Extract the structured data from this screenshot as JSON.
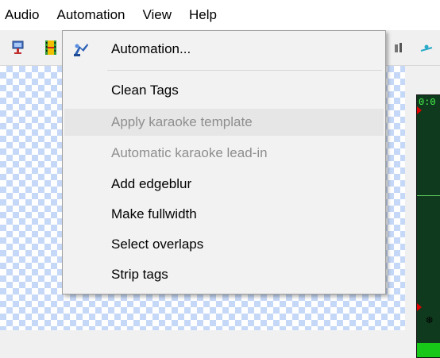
{
  "menubar": {
    "items": [
      "Audio",
      "Automation",
      "View",
      "Help"
    ]
  },
  "automation_menu": {
    "items": [
      {
        "label": "Automation...",
        "enabled": true,
        "icon": "automation-robot-icon"
      },
      {
        "label": "Clean Tags",
        "enabled": true
      },
      {
        "label": "Apply karaoke template",
        "enabled": false,
        "hovered": true
      },
      {
        "label": "Automatic karaoke lead-in",
        "enabled": false
      },
      {
        "label": "Add edgeblur",
        "enabled": true
      },
      {
        "label": "Make fullwidth",
        "enabled": true
      },
      {
        "label": "Select overlaps",
        "enabled": true
      },
      {
        "label": "Strip tags",
        "enabled": true
      }
    ]
  },
  "toolbar": {
    "icons": [
      "style-manager-icon",
      "film-strip-icon",
      "audio-icon",
      "pen-icon"
    ]
  },
  "audio_panel": {
    "time_display": "0:0",
    "glyph": "❆"
  },
  "colors": {
    "checker": "#c6d8f7",
    "audio_background": "#0f3a1e",
    "audio_text": "#4cff4c",
    "audio_marker": "#e00000",
    "audio_bar": "#18c818",
    "menu_hover": "#e6e6e6",
    "menu_disabled_text": "#8e8e8e"
  }
}
